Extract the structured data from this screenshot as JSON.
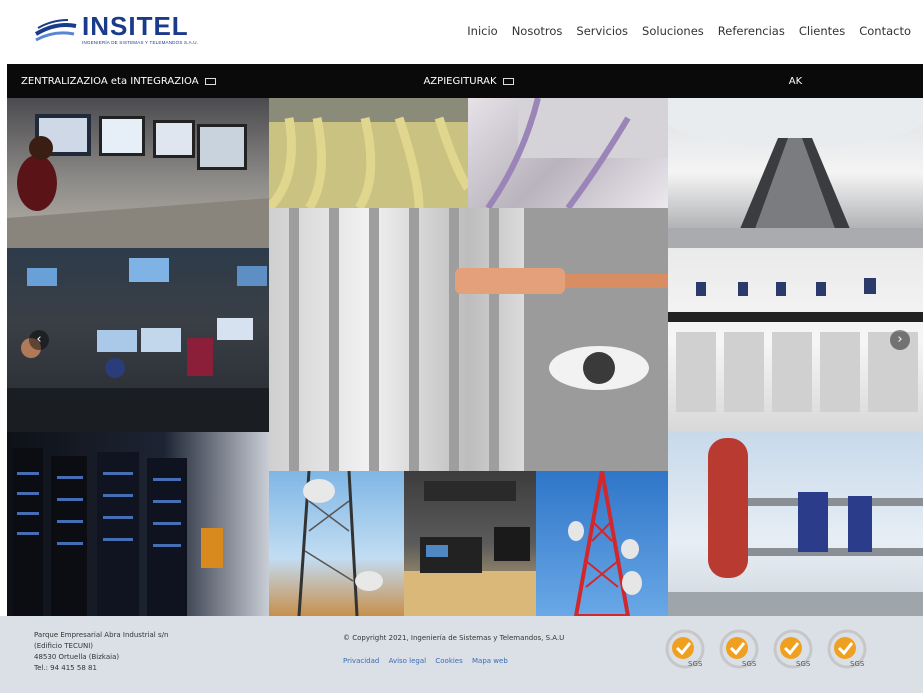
{
  "header": {
    "logo_text": "INSITEL",
    "logo_sub": "INGENIERÍA DE SISTEMAS Y TELEMANDOS S.A.U.",
    "nav": [
      "Inicio",
      "Nosotros",
      "Servicios",
      "Soluciones",
      "Referencias",
      "Clientes",
      "Contacto"
    ]
  },
  "columns": [
    {
      "title": "ZENTRALIZAZIOA eta INTEGRAZIOA"
    },
    {
      "title": "AZPIEGITURAK"
    },
    {
      "title": "AK"
    }
  ],
  "slider": {
    "prev_icon": "chevron-left-icon",
    "next_icon": "chevron-right-icon"
  },
  "footer": {
    "address": [
      "Parque Empresarial Abra Industrial s/n",
      "(Edificio TECUNI)",
      "48530 Ortuella (Bizkaia)",
      "Tel.: 94 415 58 81"
    ],
    "copyright": "© Copyright 2021, Ingeniería de Sistemas y Telemandos, S.A.U",
    "links": [
      "Privacidad",
      "Aviso legal",
      "Cookies",
      "Mapa web"
    ],
    "badge_label": "SGS"
  },
  "colors": {
    "brand": "#1a3a8a",
    "link": "#3b6bb3",
    "badge": "#f0a020",
    "footer_bg": "#dbe0e6"
  }
}
